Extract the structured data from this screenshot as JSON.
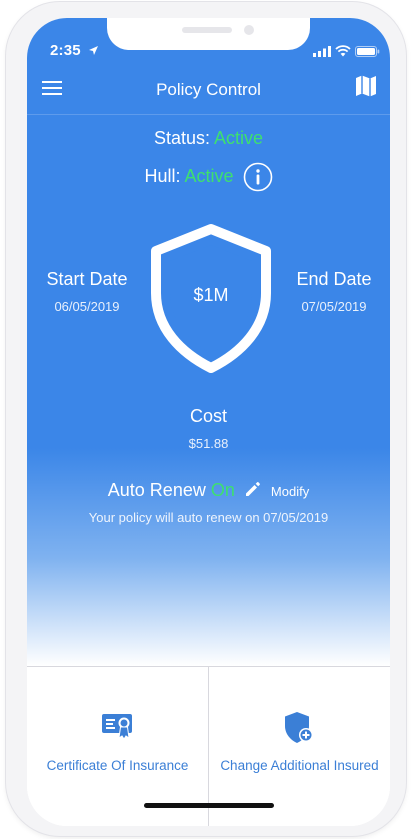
{
  "status_bar": {
    "time": "2:35"
  },
  "nav": {
    "title": "Policy Control",
    "menu_icon": "hamburger-icon",
    "map_icon": "map-icon"
  },
  "policy": {
    "status_label": "Status:",
    "status_value": "Active",
    "hull_label": "Hull:",
    "hull_value": "Active",
    "start_label": "Start Date",
    "start_value": "06/05/2019",
    "end_label": "End Date",
    "end_value": "07/05/2019",
    "coverage": "$1M",
    "cost_label": "Cost",
    "cost_value": "$51.88",
    "auto_renew_label": "Auto Renew",
    "auto_renew_value": "On",
    "modify_label": "Modify",
    "auto_renew_note": "Your policy will auto renew on 07/05/2019"
  },
  "actions": [
    {
      "label": "Certificate Of Insurance",
      "icon": "certificate-icon"
    },
    {
      "label": "Change Additional Insured",
      "icon": "shield-plus-icon"
    }
  ],
  "colors": {
    "primary": "#3b86e8",
    "active_green": "#3ee06f",
    "link_blue": "#3b7fd6"
  }
}
